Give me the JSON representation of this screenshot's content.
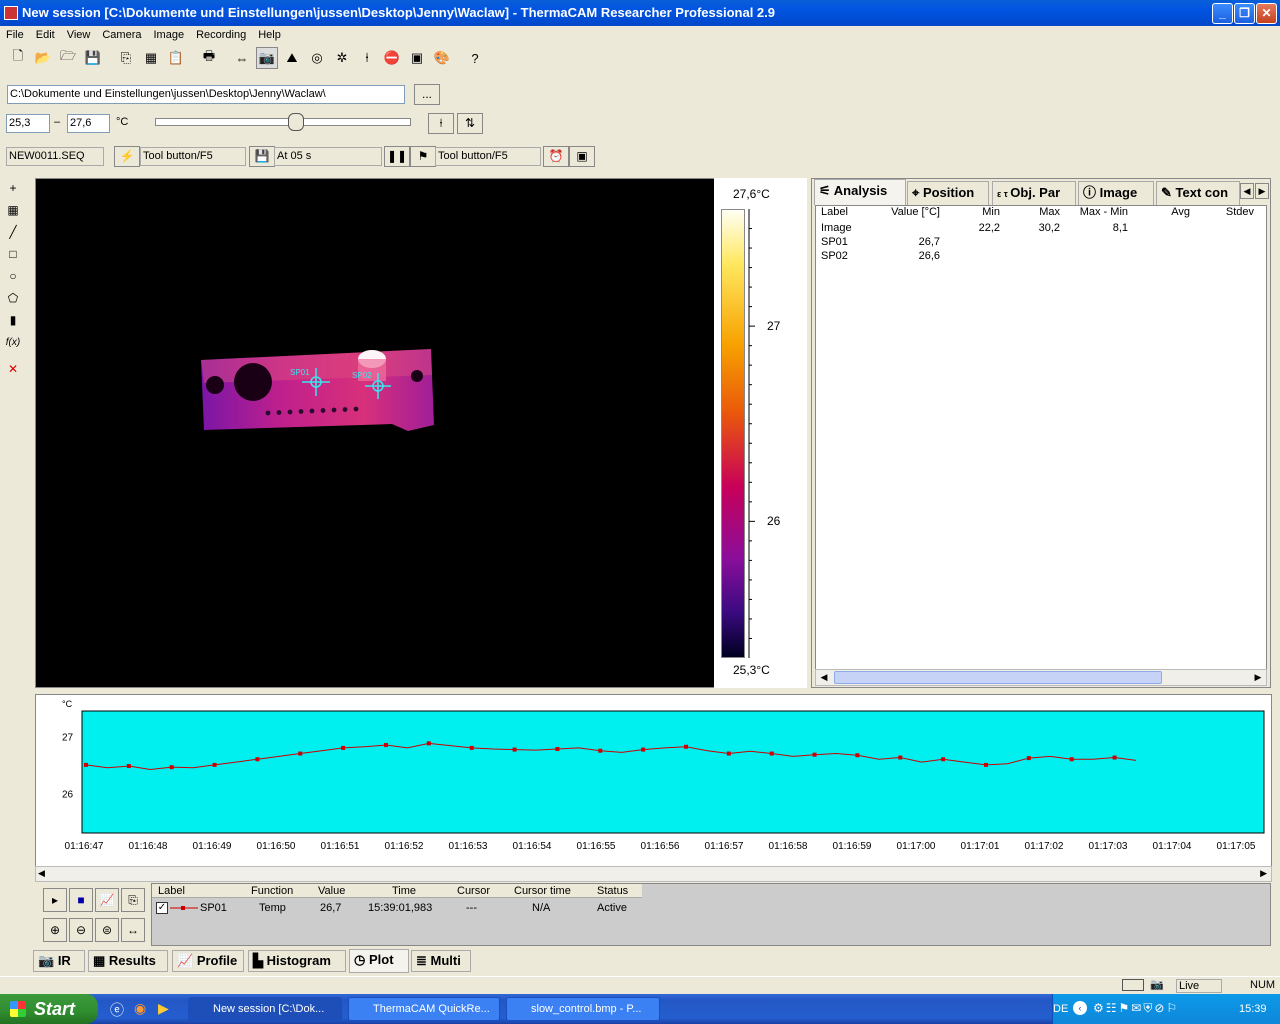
{
  "window": {
    "title": "New session [C:\\Dokumente und Einstellungen\\jussen\\Desktop\\Jenny\\Waclaw] - ThermaCAM Researcher Professional 2.9"
  },
  "menu": [
    "File",
    "Edit",
    "View",
    "Camera",
    "Image",
    "Recording",
    "Help"
  ],
  "toolbar1_icons": [
    "new-icon",
    "open-icon",
    "open-folder-icon",
    "save-icon",
    "copy-icon",
    "copy-image-icon",
    "paste-icon",
    "print-icon",
    "connect-icon",
    "camera-icon",
    "image-icon",
    "target-icon",
    "settings-icon",
    "pointer-icon",
    "stop-icon",
    "camera-settings-icon",
    "palette-icon",
    "help-icon"
  ],
  "path": {
    "value": "C:\\Dokumente und Einstellungen\\jussen\\Desktop\\Jenny\\Waclaw\\",
    "browse_label": "..."
  },
  "range": {
    "min": "25,3",
    "sep": "–",
    "max": "27,6",
    "unit": "°C",
    "slider_fraction": 0.55
  },
  "recording": {
    "file": "NEW0011.SEQ",
    "trigger1": "Tool button/F5",
    "at": "At 05 s",
    "trigger2": "Tool button/F5"
  },
  "lefttools": [
    {
      "icon": "crosshair-icon",
      "glyph": "+"
    },
    {
      "icon": "spot-value-icon",
      "glyph": "▦"
    },
    {
      "icon": "line-icon",
      "glyph": "╱"
    },
    {
      "icon": "rectangle-icon",
      "glyph": "□"
    },
    {
      "icon": "circle-icon",
      "glyph": "○"
    },
    {
      "icon": "polygon-icon",
      "glyph": "⬠"
    },
    {
      "icon": "isotherm-icon",
      "glyph": "▮"
    },
    {
      "icon": "formula-icon",
      "glyph": "f(x)"
    },
    {
      "icon": "delete-icon",
      "glyph": "✕"
    }
  ],
  "ir": {
    "spots": [
      {
        "label": "SP01"
      },
      {
        "label": "SP02"
      }
    ],
    "scale_max": "27,6°C",
    "scale_min": "25,3°C",
    "ticks": [
      {
        "label": "27",
        "value": 27
      },
      {
        "label": "26",
        "value": 26
      }
    ],
    "colors": {
      "hot": "#fffbe0",
      "warm": "#f7a200",
      "mid": "#c8005a",
      "cool": "#6a0c9a",
      "cold": "#000020",
      "spot": "#39e6f0"
    }
  },
  "analysis": {
    "tabs": [
      {
        "label": "Analysis",
        "icon": "analysis-icon"
      },
      {
        "label": "Position",
        "icon": "position-icon"
      },
      {
        "label": "Obj. Par",
        "icon": "object-params-icon"
      },
      {
        "label": "Image",
        "icon": "info-icon"
      },
      {
        "label": "Text con",
        "icon": "text-comment-icon"
      }
    ],
    "columns": [
      "Label",
      "Value [°C]",
      "Min",
      "Max",
      "Max - Min",
      "Avg",
      "Stdev"
    ],
    "rows": [
      [
        "Image",
        "",
        "22,2",
        "30,2",
        "8,1",
        "",
        ""
      ],
      [
        "SP01",
        "26,7",
        "",
        "",
        "",
        "",
        ""
      ],
      [
        "SP02",
        "26,6",
        "",
        "",
        "",
        "",
        ""
      ]
    ]
  },
  "plot": {
    "unit": "°C",
    "bg": "#00f0f0",
    "line_color": "#cc0000",
    "y_ticks": [
      "27",
      "26"
    ],
    "x_ticks": [
      "01:16:47",
      "01:16:48",
      "01:16:49",
      "01:16:50",
      "01:16:51",
      "01:16:52",
      "01:16:53",
      "01:16:54",
      "01:16:55",
      "01:16:56",
      "01:16:57",
      "01:16:58",
      "01:16:59",
      "01:17:00",
      "01:17:01",
      "01:17:02",
      "01:17:03",
      "01:17:04",
      "01:17:05"
    ],
    "series_values": [
      26.5,
      26.45,
      26.48,
      26.42,
      26.46,
      26.45,
      26.5,
      26.55,
      26.6,
      26.65,
      26.7,
      26.75,
      26.8,
      26.82,
      26.85,
      26.8,
      26.88,
      26.84,
      26.8,
      26.78,
      26.77,
      26.76,
      26.78,
      26.8,
      26.75,
      26.72,
      26.77,
      26.8,
      26.82,
      26.75,
      26.7,
      26.74,
      26.7,
      26.65,
      26.68,
      26.7,
      26.67,
      26.6,
      26.63,
      26.55,
      26.6,
      26.55,
      26.5,
      26.52,
      26.62,
      26.65,
      26.6,
      26.6,
      26.63,
      26.58
    ]
  },
  "plotgrid": {
    "columns": [
      "Label",
      "Function",
      "Value",
      "Time",
      "Cursor",
      "Cursor time",
      "Status"
    ],
    "row": [
      "SP01",
      "Temp",
      "26,7",
      "15:39:01,983",
      "---",
      "N/A",
      "Active"
    ]
  },
  "plotbuttons": [
    "play-icon",
    "stop-icon",
    "axis-settings-icon",
    "export-icon",
    "zoom-in-icon",
    "zoom-out-icon",
    "zoom-reset-icon",
    "fit-icon"
  ],
  "viewtabs": [
    {
      "label": "IR",
      "icon": "ir-camera-icon"
    },
    {
      "label": "Results",
      "icon": "results-icon"
    },
    {
      "label": "Profile",
      "icon": "profile-icon"
    },
    {
      "label": "Histogram",
      "icon": "histogram-icon"
    },
    {
      "label": "Plot",
      "icon": "plot-icon"
    },
    {
      "label": "Multi",
      "icon": "multi-icon"
    }
  ],
  "status": {
    "live": "Live",
    "num": "NUM"
  },
  "taskbar": {
    "start": "Start",
    "items": [
      "New session [C:\\Dok...",
      "ThermaCAM QuickRe...",
      "slow_control.bmp - P..."
    ],
    "lang": "DE",
    "clock": "15:39"
  }
}
